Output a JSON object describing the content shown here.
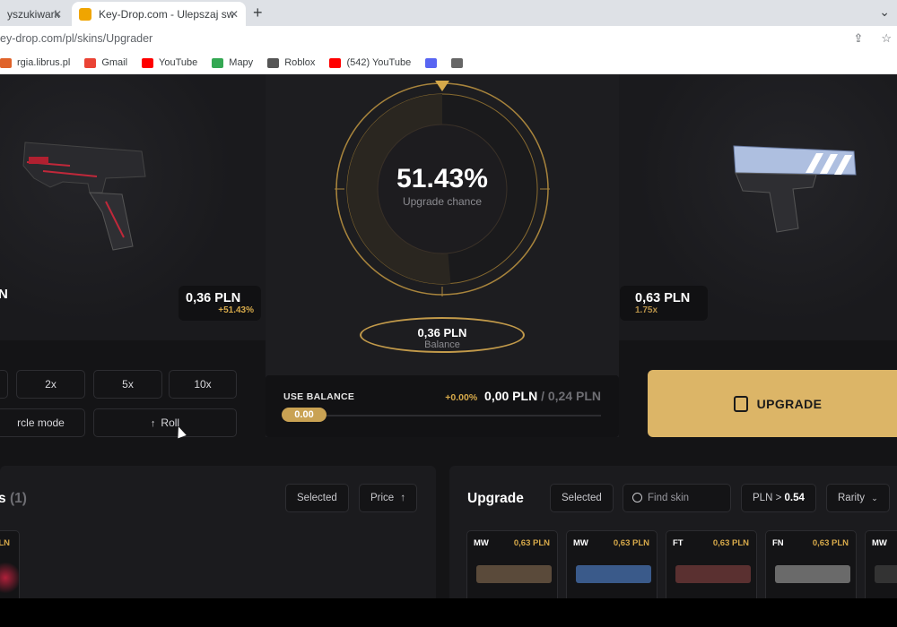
{
  "browser": {
    "tabs": [
      {
        "label": "yszukiwark",
        "active": false
      },
      {
        "label": "Key-Drop.com - Ulepszaj swoje s",
        "active": true
      }
    ],
    "new_tab": "+",
    "tab_menu": "⌄",
    "close_glyph": "✕",
    "url": "ey-drop.com/pl/skins/Upgrader",
    "bookmarks": [
      {
        "label": "rgia.librus.pl",
        "color": "#e0632a"
      },
      {
        "label": "Gmail",
        "color": "#ea4335"
      },
      {
        "label": "YouTube",
        "color": "#ff0000"
      },
      {
        "label": "Mapy",
        "color": "#34a853"
      },
      {
        "label": "Roblox",
        "color": "#555555"
      },
      {
        "label": "(542) YouTube",
        "color": "#ff0000"
      },
      {
        "label": "",
        "color": "#5865f2"
      },
      {
        "label": "",
        "color": "#666666"
      }
    ]
  },
  "upgrader": {
    "left_item": {
      "name_fragment": "N",
      "price": "0,36 PLN",
      "gain": "+51.43%"
    },
    "chance": {
      "value": "51.43%",
      "label": "Upgrade chance",
      "fraction": 0.5143
    },
    "balance": {
      "amount": "0,36 PLN",
      "label": "Balance"
    },
    "right_item": {
      "price": "0,63 PLN",
      "multiplier": "1.75x"
    },
    "use_balance": {
      "title": "USE BALANCE",
      "percent": "+0.00%",
      "amount": "0,00 PLN",
      "separator": "/",
      "max": "0,24 PLN",
      "slider_value": "0.00"
    },
    "multipliers": [
      "2x",
      "5x",
      "10x"
    ],
    "mode_button": "rcle mode",
    "roll_button": "Roll",
    "roll_icon": "↑",
    "upgrade_button": "UPGRADE"
  },
  "inventory": {
    "title": "s",
    "count": "(1)",
    "selected": "Selected",
    "price_sort": "Price",
    "sort_icon": "↑",
    "card_price_fragment": "LN"
  },
  "upgrade_list": {
    "title": "Upgrade",
    "selected": "Selected",
    "search_placeholder": "Find skin",
    "price_filter_label": "PLN >",
    "price_filter_value": "0.54",
    "rarity": "Rarity",
    "cards": [
      {
        "wear": "MW",
        "price": "0,63 PLN",
        "color": "#5a4a3a"
      },
      {
        "wear": "MW",
        "price": "0,63 PLN",
        "color": "#3a5a8a"
      },
      {
        "wear": "FT",
        "price": "0,63 PLN",
        "color": "#5a3030"
      },
      {
        "wear": "FN",
        "price": "0,63 PLN",
        "color": "#6a6a6a"
      },
      {
        "wear": "MW",
        "price": "",
        "color": "#333333"
      }
    ]
  }
}
